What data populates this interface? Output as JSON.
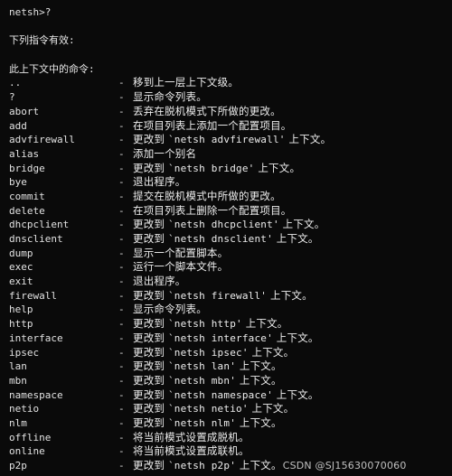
{
  "terminal": {
    "background_color": "#0a0a0a",
    "text_color": "#e2e2e2",
    "prompt_line": "netsh>?",
    "header_lines": [
      "下列指令有效:",
      "此上下文中的命令:"
    ],
    "separator": "-",
    "watermark": "CSDN @SJ15630070060",
    "commands": [
      {
        "name": "..",
        "desc": "移到上一层上下文级。"
      },
      {
        "name": "?",
        "desc": "显示命令列表。"
      },
      {
        "name": "abort",
        "desc": "丢弃在脱机模式下所做的更改。"
      },
      {
        "name": "add",
        "desc": "在项目列表上添加一个配置项目。"
      },
      {
        "name": "advfirewall",
        "desc": "更改到 `netsh advfirewall' 上下文。"
      },
      {
        "name": "alias",
        "desc": "添加一个别名"
      },
      {
        "name": "bridge",
        "desc": "更改到 `netsh bridge' 上下文。"
      },
      {
        "name": "bye",
        "desc": "退出程序。"
      },
      {
        "name": "commit",
        "desc": "提交在脱机模式中所做的更改。"
      },
      {
        "name": "delete",
        "desc": "在项目列表上删除一个配置项目。"
      },
      {
        "name": "dhcpclient",
        "desc": "更改到 `netsh dhcpclient' 上下文。"
      },
      {
        "name": "dnsclient",
        "desc": "更改到 `netsh dnsclient' 上下文。"
      },
      {
        "name": "dump",
        "desc": "显示一个配置脚本。"
      },
      {
        "name": "exec",
        "desc": "运行一个脚本文件。"
      },
      {
        "name": "exit",
        "desc": "退出程序。"
      },
      {
        "name": "firewall",
        "desc": "更改到 `netsh firewall' 上下文。"
      },
      {
        "name": "help",
        "desc": "显示命令列表。"
      },
      {
        "name": "http",
        "desc": "更改到 `netsh http' 上下文。"
      },
      {
        "name": "interface",
        "desc": "更改到 `netsh interface' 上下文。"
      },
      {
        "name": "ipsec",
        "desc": "更改到 `netsh ipsec' 上下文。"
      },
      {
        "name": "lan",
        "desc": "更改到 `netsh lan' 上下文。"
      },
      {
        "name": "mbn",
        "desc": "更改到 `netsh mbn' 上下文。"
      },
      {
        "name": "namespace",
        "desc": "更改到 `netsh namespace' 上下文。"
      },
      {
        "name": "netio",
        "desc": "更改到 `netsh netio' 上下文。"
      },
      {
        "name": "nlm",
        "desc": "更改到 `netsh nlm' 上下文。"
      },
      {
        "name": "offline",
        "desc": "将当前模式设置成脱机。"
      },
      {
        "name": "online",
        "desc": "将当前模式设置成联机。"
      },
      {
        "name": "p2p",
        "desc": "更改到 `netsh p2p' 上下文。"
      }
    ]
  }
}
